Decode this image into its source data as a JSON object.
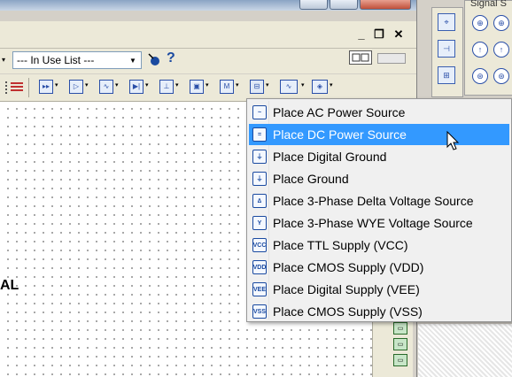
{
  "top_panel_label": "Signal S",
  "in_use_list": {
    "value": "--- In Use List ---"
  },
  "help_icon_glyph": "?",
  "canvas_text": "AL",
  "menu": {
    "items": [
      {
        "label": "Place AC Power Source",
        "icon": "ac-power-icon",
        "icon_glyph": "~"
      },
      {
        "label": "Place DC Power Source",
        "icon": "dc-power-icon",
        "icon_glyph": "="
      },
      {
        "label": "Place Digital Ground",
        "icon": "digital-ground-icon",
        "icon_glyph": "⏚"
      },
      {
        "label": "Place Ground",
        "icon": "ground-icon",
        "icon_glyph": "⏚"
      },
      {
        "label": "Place 3-Phase Delta Voltage Source",
        "icon": "three-phase-delta-icon",
        "icon_glyph": "∆"
      },
      {
        "label": "Place 3-Phase WYE Voltage Source",
        "icon": "three-phase-wye-icon",
        "icon_glyph": "Y"
      },
      {
        "label": "Place TTL Supply (VCC)",
        "icon": "vcc-icon",
        "icon_glyph": "VCC"
      },
      {
        "label": "Place CMOS Supply (VDD)",
        "icon": "vdd-icon",
        "icon_glyph": "VDD"
      },
      {
        "label": "Place Digital Supply (VEE)",
        "icon": "vee-icon",
        "icon_glyph": "VEE"
      },
      {
        "label": "Place CMOS Supply (VSS)",
        "icon": "vss-icon",
        "icon_glyph": "VSS"
      }
    ],
    "highlighted_index": 1
  },
  "colors": {
    "highlight": "#3399ff",
    "menu_bg": "#f0f0f0",
    "toolbar_bg": "#ece9d8"
  }
}
